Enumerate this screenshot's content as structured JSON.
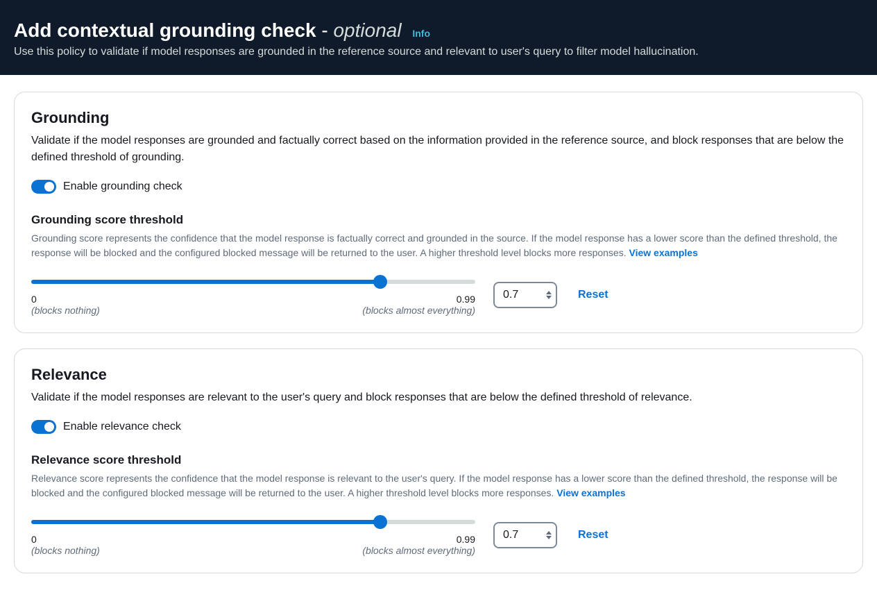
{
  "header": {
    "title_main": "Add contextual grounding check",
    "dash": " - ",
    "title_optional": "optional",
    "info_label": "Info",
    "subtitle": "Use this policy to validate if model responses are grounded in the reference source and relevant to user's query to filter model hallucination."
  },
  "grounding": {
    "title": "Grounding",
    "description": "Validate if the model responses are grounded and factually correct based on the information provided in the reference source, and block responses that are below the defined threshold of grounding.",
    "toggle_label": "Enable grounding check",
    "toggle_on": true,
    "threshold_heading": "Grounding score threshold",
    "threshold_desc": "Grounding score represents the confidence that the model response is factually correct and grounded in the source. If the model response has a lower score than the defined threshold, the response will be blocked and the configured blocked message will be returned to the user. A higher threshold level blocks more responses. ",
    "view_examples": "View examples",
    "slider": {
      "min_val": "0",
      "min_hint": "(blocks nothing)",
      "max_val": "0.99",
      "max_hint": "(blocks almost everything)",
      "value": "0.7",
      "fill_percent": 78.6
    },
    "reset_label": "Reset"
  },
  "relevance": {
    "title": "Relevance",
    "description": "Validate if the model responses are relevant to the user's query and block responses that are below the defined threshold of relevance.",
    "toggle_label": "Enable relevance check",
    "toggle_on": true,
    "threshold_heading": "Relevance score threshold",
    "threshold_desc": "Relevance score represents the confidence that the model response is relevant to the user's query. If the model response has a lower score than the defined threshold, the response will be blocked and the configured blocked message will be returned to the user. A higher threshold level blocks more responses. ",
    "view_examples": "View examples",
    "slider": {
      "min_val": "0",
      "min_hint": "(blocks nothing)",
      "max_val": "0.99",
      "max_hint": "(blocks almost everything)",
      "value": "0.7",
      "fill_percent": 78.6
    },
    "reset_label": "Reset"
  }
}
